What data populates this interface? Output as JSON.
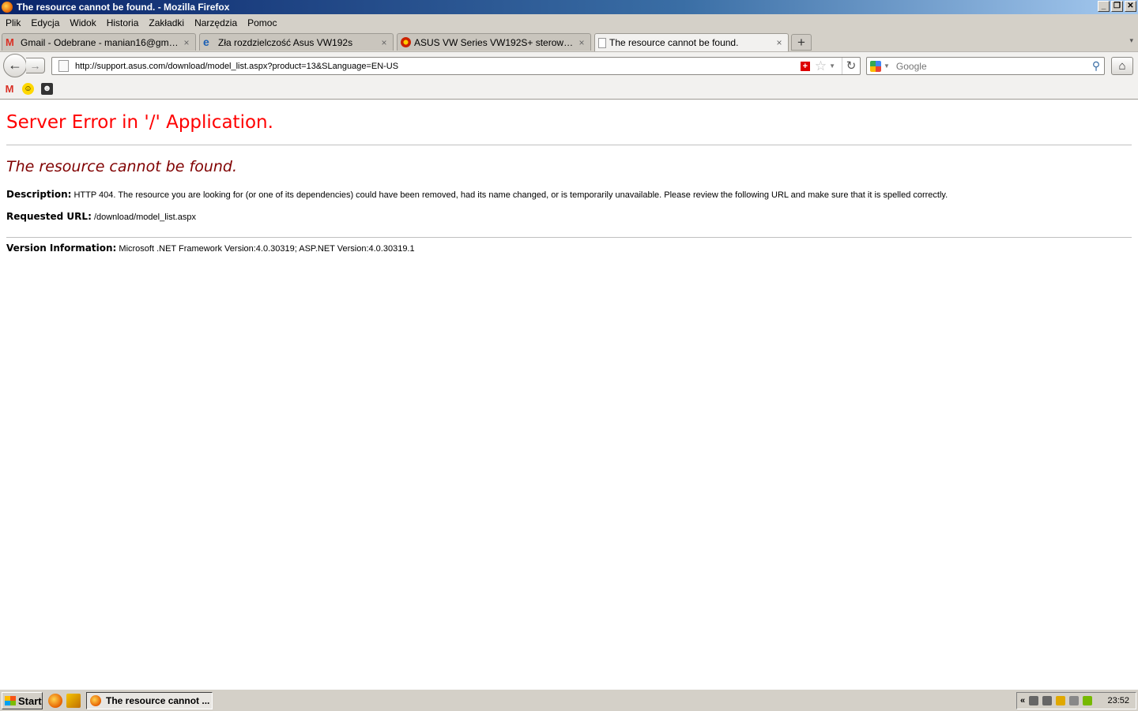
{
  "window": {
    "title": "The resource cannot be found. - Mozilla Firefox",
    "minimize": "_",
    "maximize": "❐",
    "close": "✕"
  },
  "menu": [
    "Plik",
    "Edycja",
    "Widok",
    "Historia",
    "Zakładki",
    "Narzędzia",
    "Pomoc"
  ],
  "tabs": [
    {
      "label": "Gmail - Odebrane - manian16@gmail.com",
      "icon": "gmail-icon"
    },
    {
      "label": "Zła rozdzielczość Asus VW192s",
      "icon": "ie-icon"
    },
    {
      "label": "ASUS VW Series VW192S+ sterowniki •• ...",
      "icon": "drivers-site-icon"
    },
    {
      "label": "The resource cannot be found.",
      "icon": "page-icon",
      "active": true
    }
  ],
  "tab_close": "×",
  "newtab_label": "+",
  "navbar": {
    "back": "←",
    "forward": "→",
    "url": "http://support.asus.com/download/model_list.aspx?product=13&SLanguage=EN-US",
    "flag": "+",
    "star": "☆",
    "reload": "↻",
    "search_placeholder": "Google",
    "search_go": "⚲",
    "home": "⌂"
  },
  "bookmarks": [
    "gmail-icon",
    "smiley-icon",
    "bookmark-icon"
  ],
  "page": {
    "title": "Server Error in '/' Application.",
    "subtitle": "The resource cannot be found.",
    "description_label": "Description:",
    "description": "HTTP 404. The resource you are looking for (or one of its dependencies) could have been removed, had its name changed, or is temporarily unavailable.  Please review the following URL and make sure that it is spelled correctly.",
    "requested_label": "Requested URL:",
    "requested_url": "/download/model_list.aspx",
    "version_label": "Version Information:",
    "version": "Microsoft .NET Framework Version:4.0.30319; ASP.NET Version:4.0.30319.1"
  },
  "taskbar": {
    "start": "Start",
    "active_task": "The resource cannot ...",
    "tray_expand": "«",
    "clock": "23:52"
  }
}
